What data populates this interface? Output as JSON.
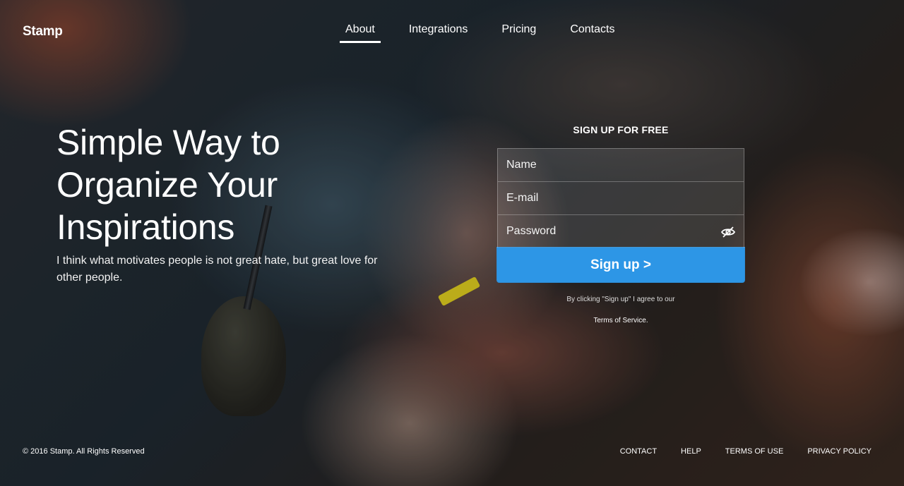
{
  "brand": {
    "name": "Stamp"
  },
  "nav": {
    "items": [
      {
        "label": "About",
        "active": true
      },
      {
        "label": "Integrations",
        "active": false
      },
      {
        "label": "Pricing",
        "active": false
      },
      {
        "label": "Contacts",
        "active": false
      }
    ]
  },
  "hero": {
    "title_line1": "Simple Way to",
    "title_line2": "Organize Your",
    "title_line3": "Inspirations",
    "subtitle": "I think what motivates people is not great hate, but great love for other people."
  },
  "signup": {
    "title": "SIGN UP FOR FREE",
    "name_placeholder": "Name",
    "email_placeholder": "E-mail",
    "password_placeholder": "Password",
    "password_toggle_icon": "eye-slash-icon",
    "button_label": "Sign up >",
    "button_color": "#2d96e6",
    "agree_text": "By clicking \"Sign up\" I agree to our",
    "terms_link": "Terms of Service."
  },
  "footer": {
    "copyright": "© 2016 Stamp. All Rights Reserved",
    "links": [
      "CONTACT",
      "HELP",
      "TERMS OF USE",
      "PRIVACY POLICY"
    ]
  }
}
